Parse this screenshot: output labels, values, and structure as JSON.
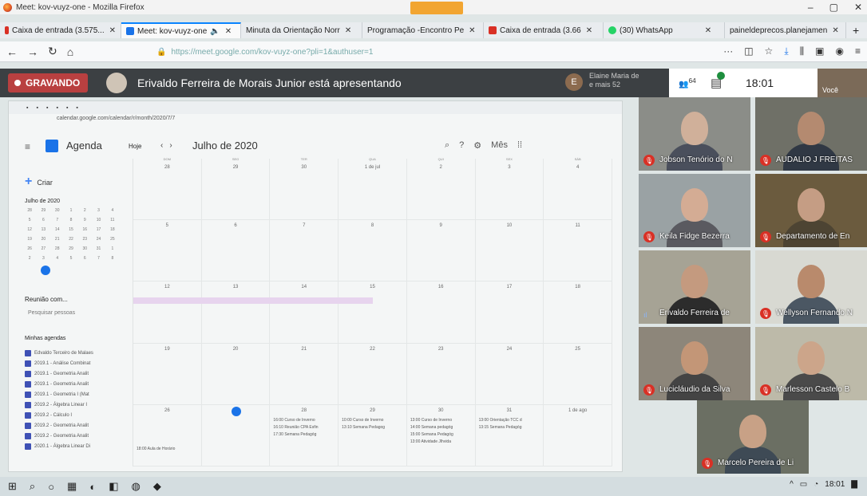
{
  "window": {
    "title": "Meet: kov-vuyz-one - Mozilla Firefox"
  },
  "window_controls": [
    "–",
    "▢",
    "✕"
  ],
  "tabs": [
    {
      "label": "Caixa de entrada (3.575...",
      "icon_color": "#d93025"
    },
    {
      "label": "Meet: kov-vuyz-one",
      "icon_color": "#1a73e8",
      "active": true
    },
    {
      "label": "Minuta da Orientação Norr",
      "icon_color": "#888888"
    },
    {
      "label": "Programação -Encontro Pe",
      "icon_color": "#888888"
    },
    {
      "label": "Caixa de entrada (3.66",
      "icon_color": "#d93025"
    },
    {
      "label": "(30) WhatsApp",
      "icon_color": "#25d366"
    },
    {
      "label": "paineldeprecos.planejamen",
      "icon_color": "#888888"
    }
  ],
  "nav": {
    "url": "https://meet.google.com/kov-vuyz-one?pli=1&authuser=1"
  },
  "meet": {
    "recording_label": "GRAVANDO",
    "presenting_text": "Erivaldo Ferreira de Morais Junior está apresentando",
    "chip_initial": "E",
    "chip_name_line1": "Elaine Maria de",
    "chip_name_line2": "e mais 52",
    "participant_count": "64",
    "clock": "18:01",
    "you_label": "Você"
  },
  "shared_screen": {
    "inner_url": "calendar.google.com/calendar/r/month/2020/7/7",
    "app_name": "Agenda",
    "today_label": "Hoje",
    "month_title": "Julho de 2020",
    "view_label": "Mês",
    "create_label": "Criar",
    "mini_month": "Julho de 2020",
    "meet_with": "Reunião com...",
    "search_people": "Pesquisar pessoas",
    "my_calendars_title": "Minhas agendas",
    "my_calendars": [
      "Edvaldo Terceiro de Malaes",
      "2019.1 - Análise Combinat",
      "2019.1 - Geometria Analit",
      "2019.1 - Geometria Analit",
      "2019.1 - Geometria I (Mat",
      "2019.2 - Álgebra Linear I",
      "2019.2 - Cálculo I",
      "2019.2 - Geometria Analit",
      "2019.2 - Geometria Analit",
      "2020.1 - Álgebra Linear Di"
    ],
    "week_days": [
      "DOM",
      "SEG",
      "TER",
      "QUA",
      "QUI",
      "SEX",
      "SÁB"
    ],
    "weeks": [
      [
        "28",
        "29",
        "30",
        "1 de jul",
        "2",
        "3",
        "4"
      ],
      [
        "5",
        "6",
        "7",
        "8",
        "9",
        "10",
        "11"
      ],
      [
        "12",
        "13",
        "14",
        "15",
        "16",
        "17",
        "18"
      ],
      [
        "19",
        "20",
        "21",
        "22",
        "23",
        "24",
        "25"
      ],
      [
        "26",
        "27",
        "28",
        "29",
        "30",
        "31",
        "1 de ago"
      ]
    ],
    "events_week5": [
      "16:00 Curso de Inverno",
      "16:10 Reunião CPA Esfin",
      "17:30 Semana Pedagóg",
      "10:00 Curso de Inverno",
      "13:10 Semana Pedagog",
      "13:00 Curso de Inverno",
      "14:00 Semana pedagóg",
      "15:00 Semana Pedagóg",
      "13:00 Orientação TCC d",
      "13:15 Semana Pedagóg",
      "18:00 Aula de Horário",
      "13:00 Atividade Jlhvida"
    ]
  },
  "participants": [
    {
      "name": "Jobson Tenório do N",
      "muted": true,
      "face": "#d0b09a",
      "body": "#4a4f5c",
      "bg": "#8b8d88"
    },
    {
      "name": "AUDALIO J FREITAS",
      "muted": true,
      "face": "#b48a70",
      "body": "#303844",
      "bg": "#6f7067"
    },
    {
      "name": "Keila Fidge Bezerra",
      "muted": true,
      "face": "#d4ac94",
      "body": "#5a5a60",
      "bg": "#9aa2a4"
    },
    {
      "name": "Departamento de En",
      "muted": true,
      "face": "#c59d84",
      "body": "#4d4433",
      "bg": "#6b5b3e"
    },
    {
      "name": "Erivaldo Ferreira de",
      "muted": false,
      "face": "#c49a7f",
      "body": "#2c2c2c",
      "bg": "#a6a395"
    },
    {
      "name": "Wellyson Fernando N",
      "muted": true,
      "face": "#b98a6c",
      "body": "#4b5763",
      "bg": "#d8d9d2"
    },
    {
      "name": "Lucicláudio da Silva",
      "muted": true,
      "face": "#c39677",
      "body": "#444",
      "bg": "#8d867a"
    },
    {
      "name": "Marlesson Castelo B",
      "muted": true,
      "face": "#cca58a",
      "body": "#4a4a4a",
      "bg": "#bdbaa9"
    },
    {
      "name": "Marcelo Pereira de Li",
      "muted": true,
      "face": "#c8a186",
      "body": "#3e4a55",
      "bg": "#6b6f63"
    }
  ],
  "taskbar": {
    "time": "18:01"
  },
  "colors": {
    "accent": "#1a73e8",
    "recording": "#b94040",
    "meet_dark": "#3c4043",
    "mute": "#d93025"
  }
}
